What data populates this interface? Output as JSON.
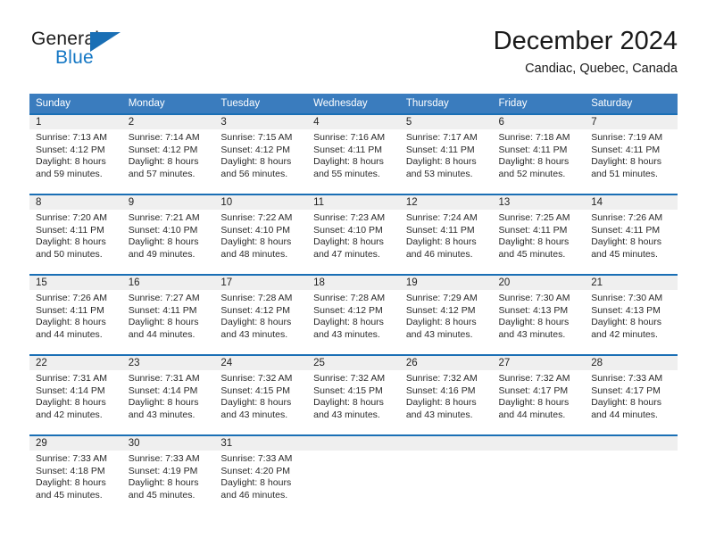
{
  "brand": {
    "name_part1": "General",
    "name_part2": "Blue",
    "logo_icon": "triangle-logo-icon"
  },
  "header": {
    "title": "December 2024",
    "subtitle": "Candiac, Quebec, Canada"
  },
  "weekdays": [
    "Sunday",
    "Monday",
    "Tuesday",
    "Wednesday",
    "Thursday",
    "Friday",
    "Saturday"
  ],
  "colors": {
    "header_blue": "#3a7cbe",
    "band_border_blue": "#1a6fb5",
    "band_gray": "#efefef",
    "brand_blue": "#1477c4"
  },
  "weeks": [
    [
      {
        "day": "1",
        "sunrise": "Sunrise: 7:13 AM",
        "sunset": "Sunset: 4:12 PM",
        "daylight1": "Daylight: 8 hours",
        "daylight2": "and 59 minutes."
      },
      {
        "day": "2",
        "sunrise": "Sunrise: 7:14 AM",
        "sunset": "Sunset: 4:12 PM",
        "daylight1": "Daylight: 8 hours",
        "daylight2": "and 57 minutes."
      },
      {
        "day": "3",
        "sunrise": "Sunrise: 7:15 AM",
        "sunset": "Sunset: 4:12 PM",
        "daylight1": "Daylight: 8 hours",
        "daylight2": "and 56 minutes."
      },
      {
        "day": "4",
        "sunrise": "Sunrise: 7:16 AM",
        "sunset": "Sunset: 4:11 PM",
        "daylight1": "Daylight: 8 hours",
        "daylight2": "and 55 minutes."
      },
      {
        "day": "5",
        "sunrise": "Sunrise: 7:17 AM",
        "sunset": "Sunset: 4:11 PM",
        "daylight1": "Daylight: 8 hours",
        "daylight2": "and 53 minutes."
      },
      {
        "day": "6",
        "sunrise": "Sunrise: 7:18 AM",
        "sunset": "Sunset: 4:11 PM",
        "daylight1": "Daylight: 8 hours",
        "daylight2": "and 52 minutes."
      },
      {
        "day": "7",
        "sunrise": "Sunrise: 7:19 AM",
        "sunset": "Sunset: 4:11 PM",
        "daylight1": "Daylight: 8 hours",
        "daylight2": "and 51 minutes."
      }
    ],
    [
      {
        "day": "8",
        "sunrise": "Sunrise: 7:20 AM",
        "sunset": "Sunset: 4:11 PM",
        "daylight1": "Daylight: 8 hours",
        "daylight2": "and 50 minutes."
      },
      {
        "day": "9",
        "sunrise": "Sunrise: 7:21 AM",
        "sunset": "Sunset: 4:10 PM",
        "daylight1": "Daylight: 8 hours",
        "daylight2": "and 49 minutes."
      },
      {
        "day": "10",
        "sunrise": "Sunrise: 7:22 AM",
        "sunset": "Sunset: 4:10 PM",
        "daylight1": "Daylight: 8 hours",
        "daylight2": "and 48 minutes."
      },
      {
        "day": "11",
        "sunrise": "Sunrise: 7:23 AM",
        "sunset": "Sunset: 4:10 PM",
        "daylight1": "Daylight: 8 hours",
        "daylight2": "and 47 minutes."
      },
      {
        "day": "12",
        "sunrise": "Sunrise: 7:24 AM",
        "sunset": "Sunset: 4:11 PM",
        "daylight1": "Daylight: 8 hours",
        "daylight2": "and 46 minutes."
      },
      {
        "day": "13",
        "sunrise": "Sunrise: 7:25 AM",
        "sunset": "Sunset: 4:11 PM",
        "daylight1": "Daylight: 8 hours",
        "daylight2": "and 45 minutes."
      },
      {
        "day": "14",
        "sunrise": "Sunrise: 7:26 AM",
        "sunset": "Sunset: 4:11 PM",
        "daylight1": "Daylight: 8 hours",
        "daylight2": "and 45 minutes."
      }
    ],
    [
      {
        "day": "15",
        "sunrise": "Sunrise: 7:26 AM",
        "sunset": "Sunset: 4:11 PM",
        "daylight1": "Daylight: 8 hours",
        "daylight2": "and 44 minutes."
      },
      {
        "day": "16",
        "sunrise": "Sunrise: 7:27 AM",
        "sunset": "Sunset: 4:11 PM",
        "daylight1": "Daylight: 8 hours",
        "daylight2": "and 44 minutes."
      },
      {
        "day": "17",
        "sunrise": "Sunrise: 7:28 AM",
        "sunset": "Sunset: 4:12 PM",
        "daylight1": "Daylight: 8 hours",
        "daylight2": "and 43 minutes."
      },
      {
        "day": "18",
        "sunrise": "Sunrise: 7:28 AM",
        "sunset": "Sunset: 4:12 PM",
        "daylight1": "Daylight: 8 hours",
        "daylight2": "and 43 minutes."
      },
      {
        "day": "19",
        "sunrise": "Sunrise: 7:29 AM",
        "sunset": "Sunset: 4:12 PM",
        "daylight1": "Daylight: 8 hours",
        "daylight2": "and 43 minutes."
      },
      {
        "day": "20",
        "sunrise": "Sunrise: 7:30 AM",
        "sunset": "Sunset: 4:13 PM",
        "daylight1": "Daylight: 8 hours",
        "daylight2": "and 43 minutes."
      },
      {
        "day": "21",
        "sunrise": "Sunrise: 7:30 AM",
        "sunset": "Sunset: 4:13 PM",
        "daylight1": "Daylight: 8 hours",
        "daylight2": "and 42 minutes."
      }
    ],
    [
      {
        "day": "22",
        "sunrise": "Sunrise: 7:31 AM",
        "sunset": "Sunset: 4:14 PM",
        "daylight1": "Daylight: 8 hours",
        "daylight2": "and 42 minutes."
      },
      {
        "day": "23",
        "sunrise": "Sunrise: 7:31 AM",
        "sunset": "Sunset: 4:14 PM",
        "daylight1": "Daylight: 8 hours",
        "daylight2": "and 43 minutes."
      },
      {
        "day": "24",
        "sunrise": "Sunrise: 7:32 AM",
        "sunset": "Sunset: 4:15 PM",
        "daylight1": "Daylight: 8 hours",
        "daylight2": "and 43 minutes."
      },
      {
        "day": "25",
        "sunrise": "Sunrise: 7:32 AM",
        "sunset": "Sunset: 4:15 PM",
        "daylight1": "Daylight: 8 hours",
        "daylight2": "and 43 minutes."
      },
      {
        "day": "26",
        "sunrise": "Sunrise: 7:32 AM",
        "sunset": "Sunset: 4:16 PM",
        "daylight1": "Daylight: 8 hours",
        "daylight2": "and 43 minutes."
      },
      {
        "day": "27",
        "sunrise": "Sunrise: 7:32 AM",
        "sunset": "Sunset: 4:17 PM",
        "daylight1": "Daylight: 8 hours",
        "daylight2": "and 44 minutes."
      },
      {
        "day": "28",
        "sunrise": "Sunrise: 7:33 AM",
        "sunset": "Sunset: 4:17 PM",
        "daylight1": "Daylight: 8 hours",
        "daylight2": "and 44 minutes."
      }
    ],
    [
      {
        "day": "29",
        "sunrise": "Sunrise: 7:33 AM",
        "sunset": "Sunset: 4:18 PM",
        "daylight1": "Daylight: 8 hours",
        "daylight2": "and 45 minutes."
      },
      {
        "day": "30",
        "sunrise": "Sunrise: 7:33 AM",
        "sunset": "Sunset: 4:19 PM",
        "daylight1": "Daylight: 8 hours",
        "daylight2": "and 45 minutes."
      },
      {
        "day": "31",
        "sunrise": "Sunrise: 7:33 AM",
        "sunset": "Sunset: 4:20 PM",
        "daylight1": "Daylight: 8 hours",
        "daylight2": "and 46 minutes."
      },
      {
        "day": "",
        "sunrise": "",
        "sunset": "",
        "daylight1": "",
        "daylight2": ""
      },
      {
        "day": "",
        "sunrise": "",
        "sunset": "",
        "daylight1": "",
        "daylight2": ""
      },
      {
        "day": "",
        "sunrise": "",
        "sunset": "",
        "daylight1": "",
        "daylight2": ""
      },
      {
        "day": "",
        "sunrise": "",
        "sunset": "",
        "daylight1": "",
        "daylight2": ""
      }
    ]
  ]
}
